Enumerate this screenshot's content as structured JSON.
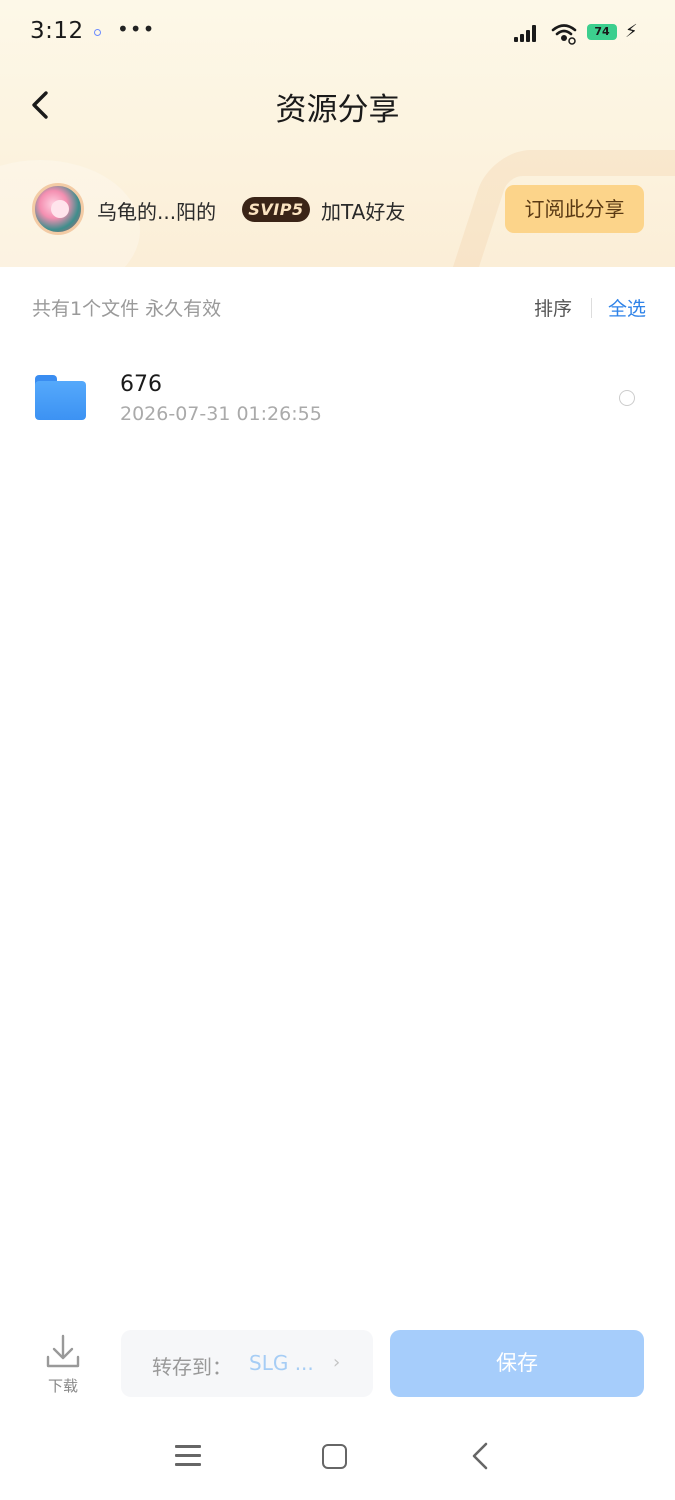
{
  "status_bar": {
    "time": "3:12",
    "more": "•••",
    "battery": "74",
    "colors": {
      "battery": "#3ccf8e",
      "dot": "#6c8cff"
    }
  },
  "header": {
    "title": "资源分享",
    "back_icon": "chevron-left-icon"
  },
  "sharer": {
    "name": "乌龟的...阳的",
    "vip_badge": "SVIP5",
    "add_friend": "加TA好友",
    "subscribe_label": "订阅此分享",
    "colors": {
      "subscribe_bg": "#fcd48a",
      "vip_bg": "#3a2417"
    }
  },
  "files_header": {
    "summary": "共有1个文件 永久有效",
    "sort_label": "排序",
    "select_all_label": "全选",
    "accent_color": "#2f83e8"
  },
  "files": [
    {
      "name": "676",
      "date": "2026-07-31  01:26:55",
      "icon": "folder-icon"
    }
  ],
  "bottom_bar": {
    "download_label": "下载",
    "transfer_label": "转存到：",
    "transfer_target": "SLG ...",
    "save_label": "保存",
    "colors": {
      "save_bg": "#a6cdfb"
    }
  },
  "nav": {
    "icons": [
      "menu-icon",
      "home-icon",
      "back-icon"
    ]
  }
}
